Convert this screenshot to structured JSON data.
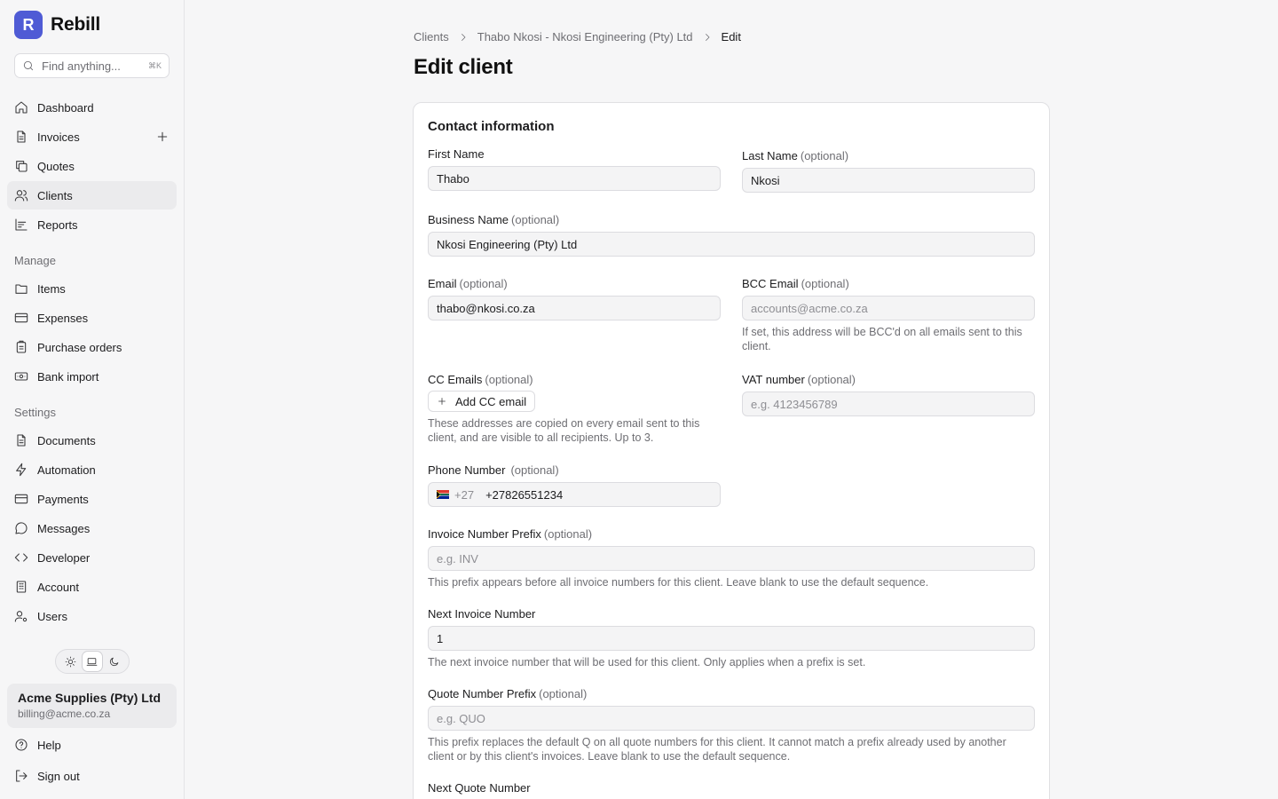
{
  "app": {
    "logo_letter": "R",
    "name": "Rebill"
  },
  "search": {
    "placeholder": "Find anything...",
    "shortcut": "⌘K"
  },
  "sidebar": {
    "main_items": [
      {
        "label": "Dashboard",
        "icon": "home-icon"
      },
      {
        "label": "Invoices",
        "icon": "file-text-icon"
      },
      {
        "label": "Quotes",
        "icon": "copy-icon"
      },
      {
        "label": "Clients",
        "icon": "users-icon",
        "active": true
      },
      {
        "label": "Reports",
        "icon": "bar-chart-icon"
      }
    ],
    "manage_heading": "Manage",
    "manage_items": [
      {
        "label": "Items",
        "icon": "folder-icon"
      },
      {
        "label": "Expenses",
        "icon": "credit-card-icon"
      },
      {
        "label": "Purchase orders",
        "icon": "clipboard-icon"
      },
      {
        "label": "Bank import",
        "icon": "banknote-icon"
      }
    ],
    "settings_heading": "Settings",
    "settings_items": [
      {
        "label": "Documents",
        "icon": "file-text-icon"
      },
      {
        "label": "Automation",
        "icon": "zap-icon"
      },
      {
        "label": "Payments",
        "icon": "credit-card-icon"
      },
      {
        "label": "Messages",
        "icon": "message-circle-icon"
      },
      {
        "label": "Developer",
        "icon": "code-icon"
      },
      {
        "label": "Account",
        "icon": "building-icon"
      },
      {
        "label": "Users",
        "icon": "user-cog-icon"
      }
    ],
    "theme_selected": "system",
    "account": {
      "name": "Acme Supplies (Pty) Ltd",
      "email": "billing@acme.co.za"
    },
    "help_label": "Help",
    "signout_label": "Sign out"
  },
  "breadcrumb": [
    "Clients",
    "Thabo Nkosi - Nkosi Engineering (Pty) Ltd",
    "Edit"
  ],
  "page_title": "Edit client",
  "form": {
    "section_title": "Contact information",
    "optional_label": "(optional)",
    "first_name": {
      "label": "First Name",
      "value": "Thabo"
    },
    "last_name": {
      "label": "Last Name",
      "value": "Nkosi"
    },
    "business_name": {
      "label": "Business Name",
      "value": "Nkosi Engineering (Pty) Ltd"
    },
    "email": {
      "label": "Email",
      "value": "thabo@nkosi.co.za"
    },
    "bcc_email": {
      "label": "BCC Email",
      "placeholder": "accounts@acme.co.za",
      "help": "If set, this address will be BCC'd on all emails sent to this client."
    },
    "cc_emails": {
      "label": "CC Emails",
      "button": "Add CC email",
      "help": "These addresses are copied on every email sent to this client, and are visible to all recipients. Up to 3."
    },
    "vat_number": {
      "label": "VAT number",
      "placeholder": "e.g. 4123456789"
    },
    "phone": {
      "label": "Phone Number",
      "dial_code": "+27",
      "value": "+27826551234"
    },
    "invoice_prefix": {
      "label": "Invoice Number Prefix",
      "placeholder": "e.g. INV",
      "help": "This prefix appears before all invoice numbers for this client. Leave blank to use the default sequence."
    },
    "next_invoice": {
      "label": "Next Invoice Number",
      "value": "1",
      "help": "The next invoice number that will be used for this client. Only applies when a prefix is set."
    },
    "quote_prefix": {
      "label": "Quote Number Prefix",
      "placeholder": "e.g. QUO",
      "help": "This prefix replaces the default Q on all quote numbers for this client. It cannot match a prefix already used by another client or by this client's invoices. Leave blank to use the default sequence."
    },
    "next_quote": {
      "label": "Next Quote Number"
    }
  },
  "colors": {
    "brand": "#4f5bd5",
    "sidebar_bg": "#f6f6f7",
    "active_item_bg": "#ebebed"
  }
}
